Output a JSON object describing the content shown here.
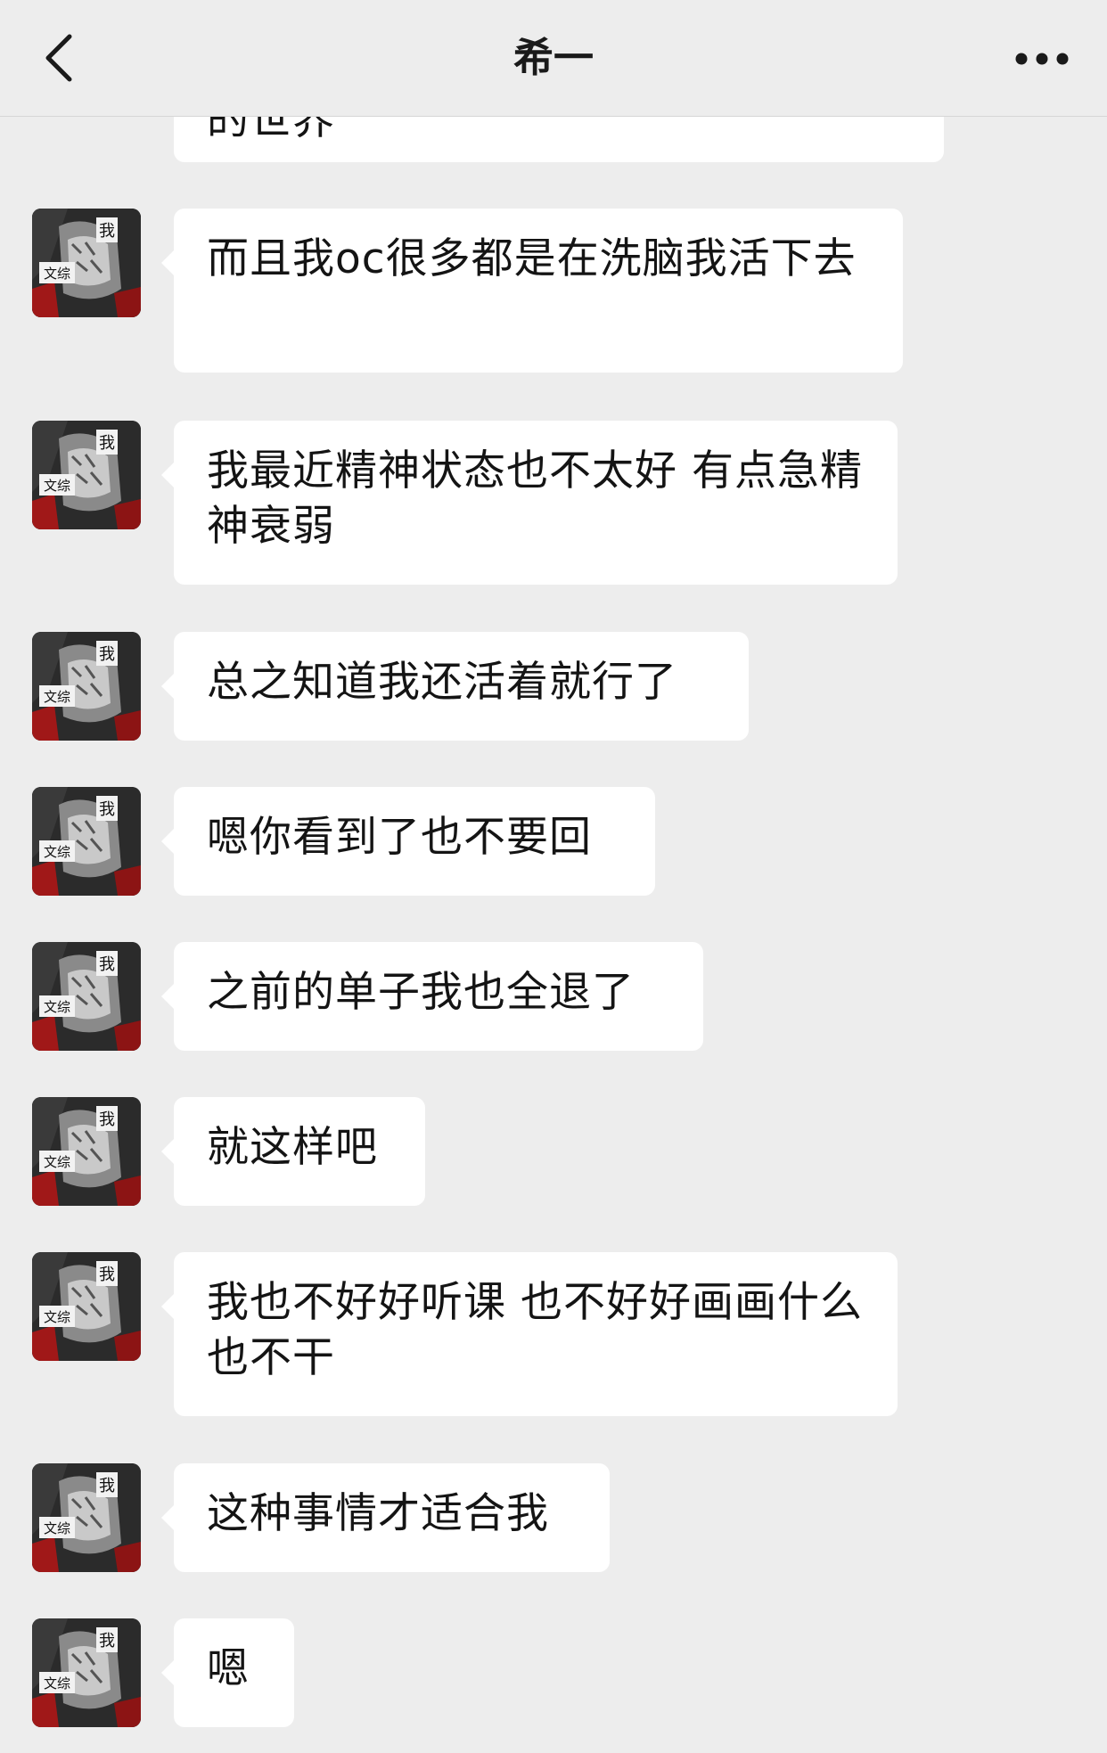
{
  "header": {
    "title": "希一",
    "back_icon": "chevron-left-icon",
    "more_icon": "more-horizontal-icon"
  },
  "contact": {
    "avatar_text_top": "我",
    "avatar_text_left": "文综"
  },
  "messages": [
    {
      "text": "的世界"
    },
    {
      "text": "而且我oc很多都是在洗脑我活下去"
    },
    {
      "text": "我最近精神状态也不太好 有点急精神衰弱"
    },
    {
      "text": "总之知道我还活着就行了"
    },
    {
      "text": "嗯你看到了也不要回"
    },
    {
      "text": "之前的单子我也全退了"
    },
    {
      "text": "就这样吧"
    },
    {
      "text": "我也不好好听课 也不好好画画什么也不干"
    },
    {
      "text": "这种事情才适合我"
    },
    {
      "text": "嗯"
    }
  ],
  "colors": {
    "background": "#ededed",
    "bubble": "#ffffff",
    "text": "#141414"
  }
}
